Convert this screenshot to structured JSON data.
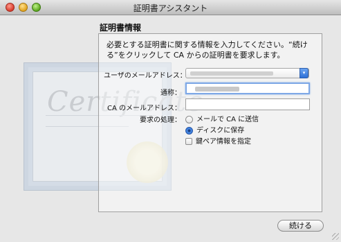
{
  "window": {
    "title": "証明書アシスタント"
  },
  "section": {
    "title": "証明書情報",
    "intro": "必要とする証明書に関する情報を入力してください。“続ける”をクリックして CA からの証明書を要求します。"
  },
  "fields": {
    "email_label": "ユーザのメールアドレス：",
    "common_name_label": "通称：",
    "ca_email_label": "CA のメールアドレス：",
    "request_label": "要求の処理："
  },
  "options": {
    "email_to_ca": "メールで CA に送信",
    "save_to_disk": "ディスクに保存",
    "specify_keypair": "鍵ペア情報を指定"
  },
  "decoration": {
    "certificate_text": "Certificate"
  },
  "buttons": {
    "continue": "続ける"
  }
}
